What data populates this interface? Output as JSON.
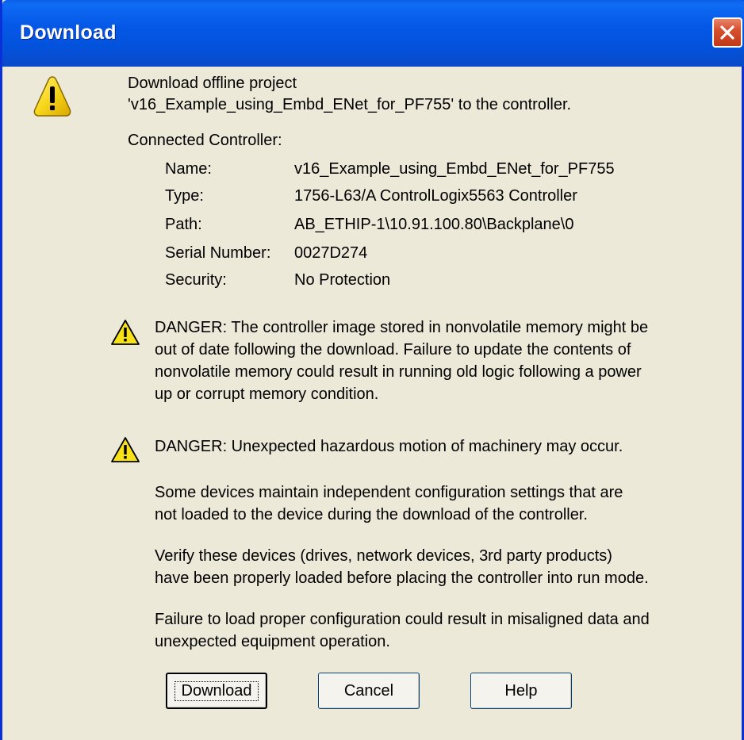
{
  "window": {
    "title": "Download"
  },
  "message": {
    "line1": "Download offline project",
    "line2": "'v16_Example_using_Embd_ENet_for_PF755' to the controller."
  },
  "connected_controller": {
    "heading": "Connected Controller:",
    "fields": [
      {
        "label": "Name:",
        "value": "v16_Example_using_Embd_ENet_for_PF755"
      },
      {
        "label": "Type:",
        "value": "1756-L63/A ControlLogix5563 Controller"
      },
      {
        "label": "Path:",
        "value": "AB_ETHIP-1\\10.91.100.80\\Backplane\\0"
      },
      {
        "label": "Serial Number:",
        "value": "0027D274"
      },
      {
        "label": "Security:",
        "value": "No Protection"
      }
    ]
  },
  "danger1": {
    "lines": [
      "DANGER: The controller image stored in nonvolatile memory might be",
      "out of date following the download. Failure to update the contents of",
      "nonvolatile memory could result in running old logic following a power",
      "up or corrupt memory condition."
    ]
  },
  "danger2": {
    "heading": "DANGER: Unexpected hazardous motion of machinery may occur.",
    "para1": [
      "Some devices maintain independent configuration settings that are",
      "not loaded to the device during the download of the controller."
    ],
    "para2": [
      "Verify these devices (drives, network devices, 3rd party products)",
      "have been properly loaded before placing the controller into run mode."
    ],
    "para3": [
      "Failure to load proper configuration could result in misaligned data and",
      "unexpected equipment operation."
    ]
  },
  "buttons": {
    "download": "Download",
    "cancel": "Cancel",
    "help": "Help"
  },
  "colors": {
    "titlebar": "#0558e6",
    "dialog_bg": "#ece9d8",
    "warning_yellow": "#f7d61a",
    "close_red": "#d7502e"
  },
  "icons": {
    "large_warning": "warning-triangle-icon",
    "small_warning": "warning-triangle-icon",
    "close": "close-x-icon"
  }
}
